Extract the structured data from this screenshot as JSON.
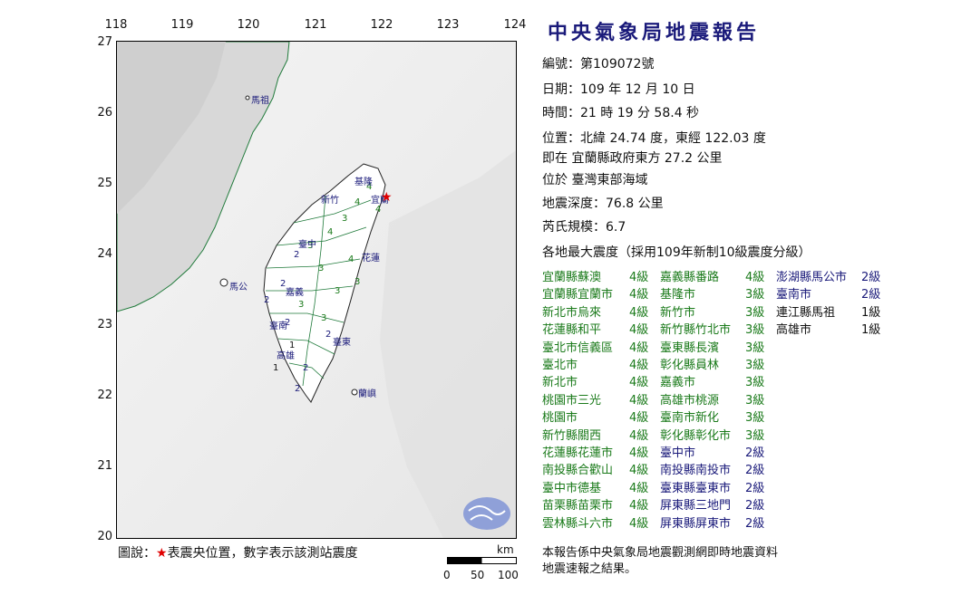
{
  "title": "中央氣象局地震報告",
  "lon_ticks": [
    "118",
    "119",
    "120",
    "121",
    "122",
    "123",
    "124"
  ],
  "lat_ticks": [
    "27",
    "26",
    "25",
    "24",
    "23",
    "22",
    "21",
    "20"
  ],
  "info": {
    "number_label": "編號：",
    "number": "第109072號",
    "date_label": "日期：",
    "date": "109 年 12 月 10 日",
    "time_label": "時間：",
    "time": "21 時 19 分 58.4 秒",
    "location_label": "位置：",
    "location": "北緯 24.74 度，東經 122.03 度",
    "relative": "即在 宜蘭縣政府東方 27.2 公里",
    "region": "位於 臺灣東部海域",
    "depth_label": "地震深度：",
    "depth": "76.8 公里",
    "magnitude_label": "芮氏規模：",
    "magnitude": "6.7",
    "intensity_header": "各地最大震度（採用109年新制10級震度分級）"
  },
  "intensities": {
    "col1": [
      {
        "place": "宜蘭縣蘇澳",
        "level": "4級"
      },
      {
        "place": "宜蘭縣宜蘭市",
        "level": "4級"
      },
      {
        "place": "新北市烏來",
        "level": "4級"
      },
      {
        "place": "花蓮縣和平",
        "level": "4級"
      },
      {
        "place": "臺北市信義區",
        "level": "4級"
      },
      {
        "place": "臺北市",
        "level": "4級"
      },
      {
        "place": "新北市",
        "level": "4級"
      },
      {
        "place": "桃園市三光",
        "level": "4級"
      },
      {
        "place": "桃園市",
        "level": "4級"
      },
      {
        "place": "新竹縣關西",
        "level": "4級"
      },
      {
        "place": "花蓮縣花蓮市",
        "level": "4級"
      },
      {
        "place": "南投縣合歡山",
        "level": "4級"
      },
      {
        "place": "臺中市德基",
        "level": "4級"
      },
      {
        "place": "苗栗縣苗栗市",
        "level": "4級"
      },
      {
        "place": "雲林縣斗六市",
        "level": "4級"
      }
    ],
    "col2": [
      {
        "place": "嘉義縣番路",
        "level": "4級"
      },
      {
        "place": "基隆市",
        "level": "3級"
      },
      {
        "place": "新竹市",
        "level": "3級"
      },
      {
        "place": "新竹縣竹北市",
        "level": "3級"
      },
      {
        "place": "臺東縣長濱",
        "level": "3級"
      },
      {
        "place": "彰化縣員林",
        "level": "3級"
      },
      {
        "place": "嘉義市",
        "level": "3級"
      },
      {
        "place": "高雄市桃源",
        "level": "3級"
      },
      {
        "place": "臺南市新化",
        "level": "3級"
      },
      {
        "place": "彰化縣彰化市",
        "level": "3級"
      },
      {
        "place": "臺中市",
        "level": "2級"
      },
      {
        "place": "南投縣南投市",
        "level": "2級"
      },
      {
        "place": "臺東縣臺東市",
        "level": "2級"
      },
      {
        "place": "屏東縣三地門",
        "level": "2級"
      },
      {
        "place": "屏東縣屏東市",
        "level": "2級"
      }
    ],
    "col3": [
      {
        "place": "澎湖縣馬公市",
        "level": "2級"
      },
      {
        "place": "臺南市",
        "level": "2級"
      },
      {
        "place": "連江縣馬祖",
        "level": "1級"
      },
      {
        "place": "高雄市",
        "level": "1級"
      }
    ]
  },
  "map_labels": {
    "matsu": "馬祖",
    "penghu": "馬公",
    "hsinchu": "新竹",
    "taichung": "臺中",
    "hualien": "花蓮",
    "chiayi": "嘉義",
    "tainan": "臺南",
    "kaohsiung": "高雄",
    "taitung": "臺東",
    "lanyu": "蘭嶼",
    "yilan": "宜蘭",
    "keelung": "基隆"
  },
  "legend": {
    "prefix": "圖說：",
    "star": "★",
    "text": "表震央位置，數字表示該測站震度"
  },
  "scale": {
    "unit": "km",
    "labels": [
      "0",
      "50",
      "100"
    ]
  },
  "note": [
    "本報告係中央氣象局地震觀測網即時地震資料",
    "地震速報之結果。"
  ],
  "colors": {
    "title": "#1a1a7a",
    "intensity_4": "#1a7a1a",
    "intensity_2": "#1a1a7a",
    "intensity_1": "#111111",
    "epicenter": "#e00000"
  }
}
